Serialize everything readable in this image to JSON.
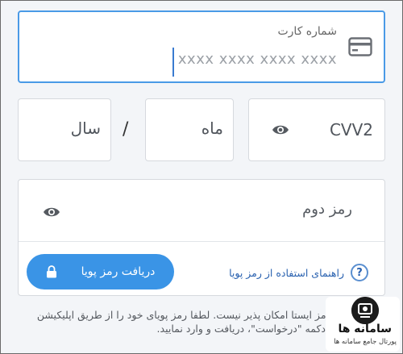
{
  "card_number": {
    "label": "شماره کارت",
    "placeholder": "xxxx xxxx xxxx xxxx",
    "icon": "credit-card-icon"
  },
  "cvv2": {
    "label": "CVV2",
    "icon": "eye-icon"
  },
  "expiry": {
    "month_label": "ماه",
    "separator": "/",
    "year_label": "سال"
  },
  "second_password": {
    "label": "رمز دوم",
    "icon": "eye-icon",
    "help_text": "راهنمای استفاده از رمز پویا",
    "help_icon_glyph": "?",
    "get_otp_button": "دریافت رمز پویا"
  },
  "hint_text": "استفاده از رمز ایستا امکان پذیر نیست. لطفا رمز پویای خود را از طریق اپلیکیشن بانک دیگر یا دکمه \"درخواست\"، دریافت و وارد نمایید.",
  "watermark": {
    "name": "سامانه ها",
    "tagline": "پورتال جامع سامانه ها"
  },
  "colors": {
    "accent": "#3a94e6",
    "focus_border": "#4a9ae6",
    "link": "#2a62b0"
  }
}
